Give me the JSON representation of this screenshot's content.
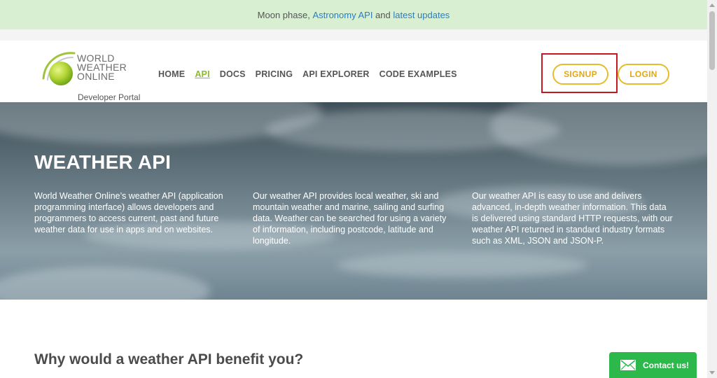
{
  "announcement": {
    "prefix": "Moon phase, ",
    "link1": "Astronomy API",
    "middle": " and ",
    "link2": "latest updates"
  },
  "logo": {
    "line1": "WORLD",
    "line2": "WEATHER",
    "line3": "ONLINE",
    "subtitle": "Developer Portal"
  },
  "nav": {
    "items": [
      {
        "label": "HOME",
        "active": false
      },
      {
        "label": "API",
        "active": true
      },
      {
        "label": "DOCS",
        "active": false
      },
      {
        "label": "PRICING",
        "active": false
      },
      {
        "label": "API EXPLORER",
        "active": false
      },
      {
        "label": "CODE EXAMPLES",
        "active": false
      }
    ]
  },
  "auth": {
    "signup": "SIGNUP",
    "login": "LOGIN"
  },
  "hero": {
    "title": "WEATHER API",
    "columns": [
      "World Weather Online’s weather API (application programming interface) allows developers and programmers to access current, past and future weather data for use in apps and on websites.",
      "Our weather API provides local weather, ski and mountain weather and marine, sailing and surfing data. Weather can be searched for using a variety of information, including postcode, latitude and longitude.",
      "Our weather API is easy to use and delivers advanced, in-depth weather information. This data is delivered using standard HTTP requests, with our weather API returned in standard industry formats such as XML, JSON and JSON-P."
    ]
  },
  "section": {
    "heading": "Why would a weather API benefit you?"
  },
  "contact": {
    "label": "Contact us!"
  },
  "colors": {
    "accent_green": "#8bbb2a",
    "button_gold": "#e8bb2c",
    "highlight_red": "#c8181f",
    "contact_green": "#2db84b",
    "announce_bg": "#d8efd2"
  }
}
